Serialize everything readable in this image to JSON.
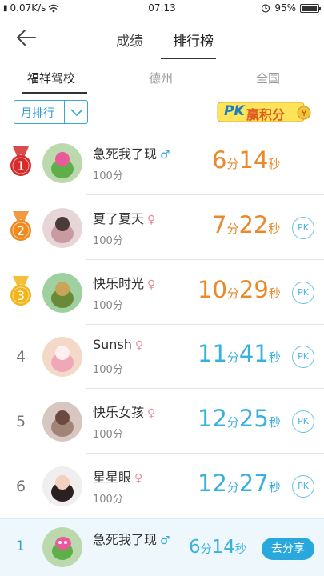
{
  "status": {
    "network_speed": "0.07K/s",
    "time": "07:13",
    "battery": "95%",
    "battery_level": 0.95
  },
  "nav": {
    "tabs": [
      "成绩",
      "排行榜"
    ],
    "active_tab": "排行榜"
  },
  "regions": {
    "tabs": [
      "福祥驾校",
      "德州",
      "全国"
    ],
    "active": "福祥驾校"
  },
  "filter": {
    "selected": "月排行"
  },
  "pk_badge": {
    "pk": "PK",
    "text": "赢积分"
  },
  "units": {
    "minute": "分",
    "second": "秒"
  },
  "leaderboard": [
    {
      "rank": "1",
      "name": "急死我了现",
      "gender": "♂",
      "score": "100分",
      "minutes": "6",
      "seconds": "14",
      "pk": ""
    },
    {
      "rank": "2",
      "name": "夏了夏天",
      "gender": "♀",
      "score": "100分",
      "minutes": "7",
      "seconds": "22",
      "pk": "PK"
    },
    {
      "rank": "3",
      "name": "快乐时光",
      "gender": "♀",
      "score": "100分",
      "minutes": "10",
      "seconds": "29",
      "pk": "PK"
    },
    {
      "rank": "4",
      "name": "Sunsh",
      "gender": "♀",
      "score": "100分",
      "minutes": "11",
      "seconds": "41",
      "pk": "PK"
    },
    {
      "rank": "5",
      "name": "快乐女孩",
      "gender": "♀",
      "score": "100分",
      "minutes": "12",
      "seconds": "25",
      "pk": "PK"
    },
    {
      "rank": "6",
      "name": "星星眼",
      "gender": "♀",
      "score": "100分",
      "minutes": "12",
      "seconds": "27",
      "pk": "PK"
    }
  ],
  "my_rank": {
    "rank": "1",
    "name": "急死我了现",
    "gender": "♂",
    "minutes": "6",
    "seconds": "14",
    "share_label": "去分享"
  },
  "colors": {
    "accent": "#28a8dd",
    "top3_time": "#e88a2c",
    "normal_time": "#3ab0df",
    "medal_gold": "#f2b417",
    "medal_red": "#d62b2b",
    "medal_orange": "#ef8a1f"
  }
}
